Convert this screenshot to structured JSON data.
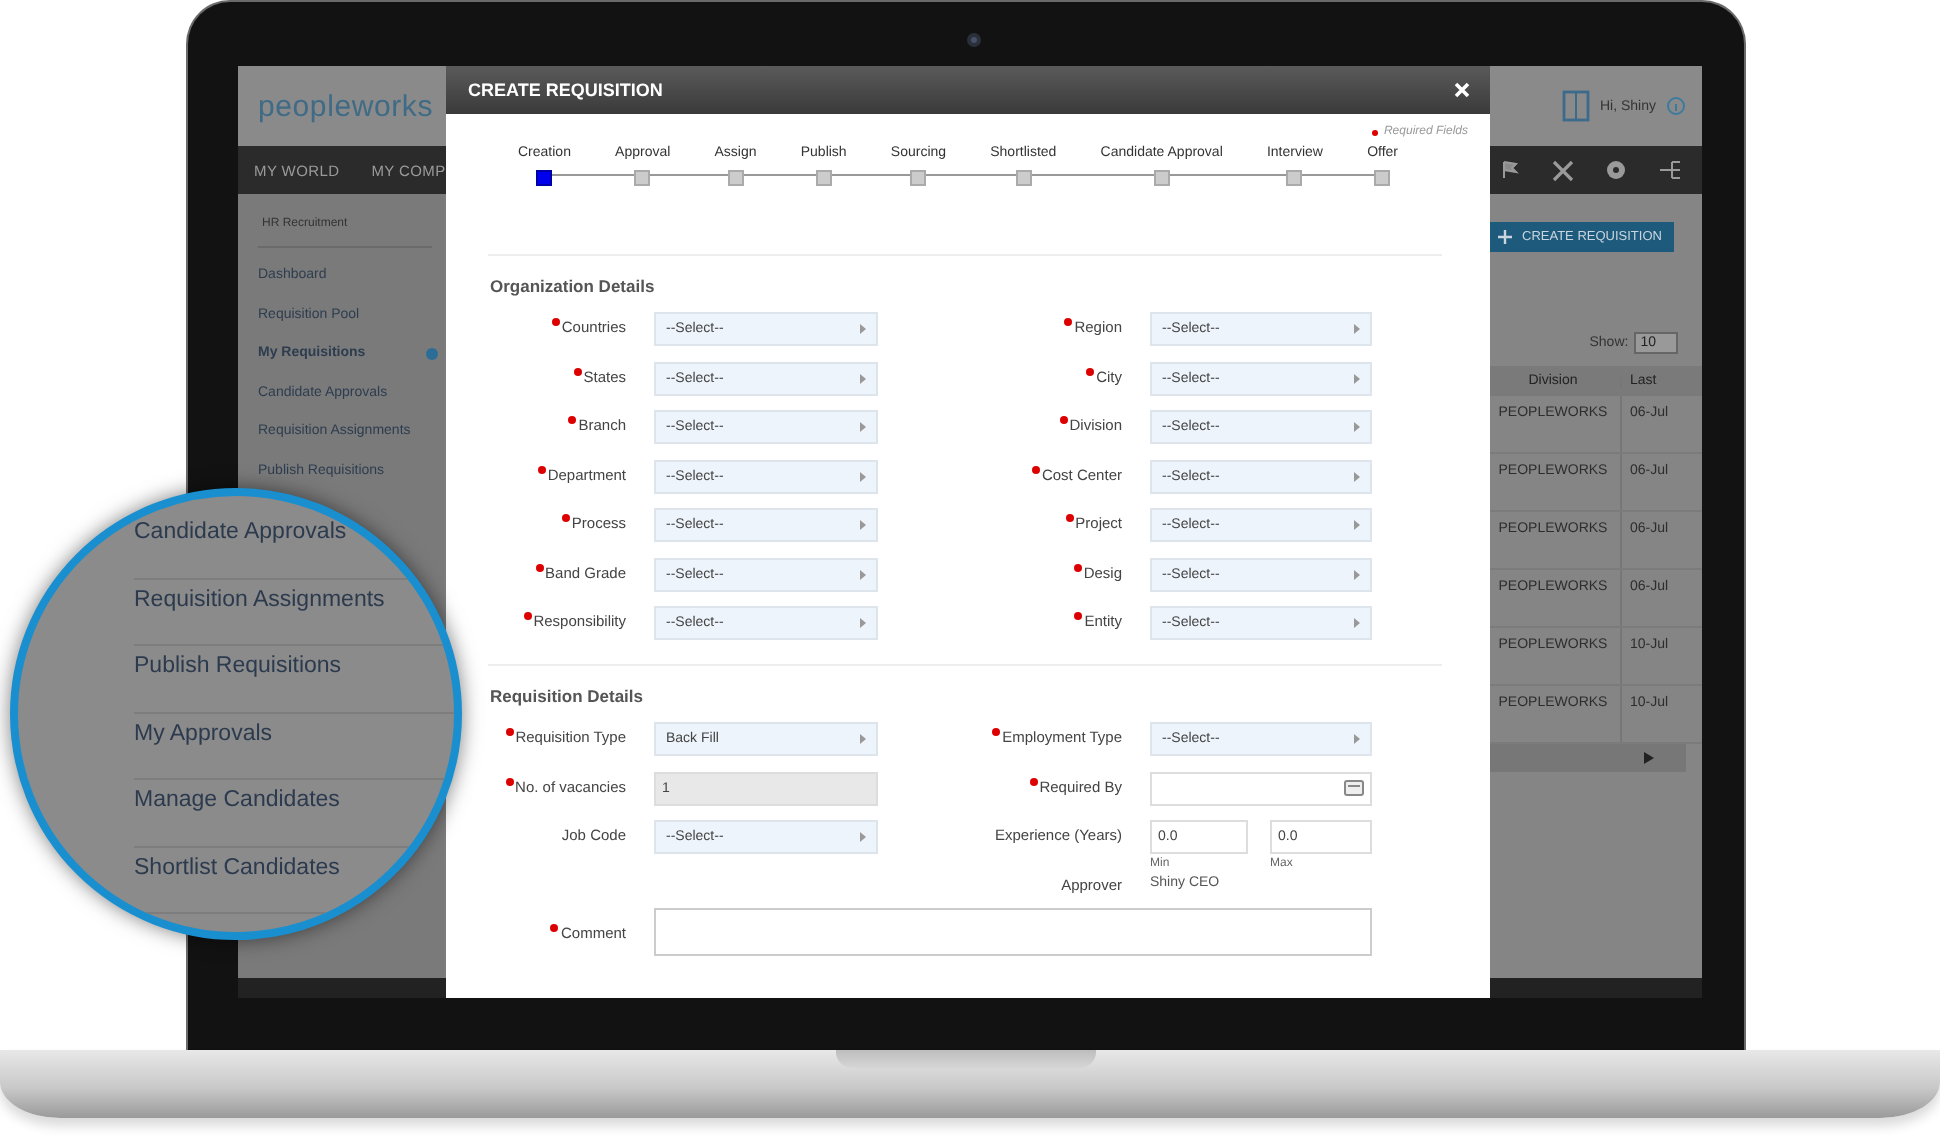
{
  "app": {
    "logo": "peopleworks",
    "greeting": "Hi, Shiny",
    "nav": [
      "MY WORLD",
      "MY COMP"
    ],
    "sidebar": {
      "heading": "HR Recruitment",
      "items": [
        {
          "label": "Dashboard",
          "selected": false
        },
        {
          "label": "Requisition Pool",
          "selected": false
        },
        {
          "label": "My Requisitions",
          "selected": true
        },
        {
          "label": "Candidate Approvals",
          "selected": false
        },
        {
          "label": "Requisition Assignments",
          "selected": false
        },
        {
          "label": "Publish Requisitions",
          "selected": false
        }
      ]
    },
    "create_button": "CREATE REQUISITION",
    "show": {
      "label": "Show:",
      "value": "10"
    },
    "table": {
      "columns": [
        "Division",
        "Last"
      ],
      "rows": [
        [
          "PEOPLEWORKS",
          "06-Jul"
        ],
        [
          "PEOPLEWORKS",
          "06-Jul"
        ],
        [
          "PEOPLEWORKS",
          "06-Jul"
        ],
        [
          "PEOPLEWORKS",
          "06-Jul"
        ],
        [
          "PEOPLEWORKS",
          "10-Jul"
        ],
        [
          "PEOPLEWORKS",
          "10-Jul"
        ]
      ]
    }
  },
  "modal": {
    "title": "CREATE REQUISITION",
    "required_note": "Required Fields",
    "steps": [
      {
        "label": "Creation",
        "selected": true
      },
      {
        "label": "Approval",
        "selected": false
      },
      {
        "label": "Assign",
        "selected": false
      },
      {
        "label": "Publish",
        "selected": false
      },
      {
        "label": "Sourcing",
        "selected": false
      },
      {
        "label": "Shortlisted",
        "selected": false
      },
      {
        "label": "Candidate Approval",
        "selected": false
      },
      {
        "label": "Interview",
        "selected": false
      },
      {
        "label": "Offer",
        "selected": false
      }
    ],
    "sections": [
      {
        "title": "Organization Details",
        "rows": [
          {
            "left": {
              "kind": "select",
              "label": "Countries",
              "required": true,
              "value": "--Select--"
            },
            "right": {
              "kind": "select",
              "label": "Region",
              "required": true,
              "value": "--Select--"
            }
          },
          {
            "left": {
              "kind": "select",
              "label": "States",
              "required": true,
              "value": "--Select--"
            },
            "right": {
              "kind": "select",
              "label": "City",
              "required": true,
              "value": "--Select--"
            }
          },
          {
            "left": {
              "kind": "select",
              "label": "Branch",
              "required": true,
              "value": "--Select--"
            },
            "right": {
              "kind": "select",
              "label": "Division",
              "required": true,
              "value": "--Select--"
            }
          },
          {
            "left": {
              "kind": "select",
              "label": "Department",
              "required": true,
              "value": "--Select--"
            },
            "right": {
              "kind": "select",
              "label": "Cost Center",
              "required": true,
              "value": "--Select--"
            }
          },
          {
            "left": {
              "kind": "select",
              "label": "Process",
              "required": true,
              "value": "--Select--"
            },
            "right": {
              "kind": "select",
              "label": "Project",
              "required": true,
              "value": "--Select--"
            }
          },
          {
            "left": {
              "kind": "select",
              "label": "Band Grade",
              "required": true,
              "value": "--Select--"
            },
            "right": {
              "kind": "select",
              "label": "Desig",
              "required": true,
              "value": "--Select--"
            }
          },
          {
            "left": {
              "kind": "select",
              "label": "Responsibility",
              "required": true,
              "value": "--Select--"
            },
            "right": {
              "kind": "select",
              "label": "Entity",
              "required": true,
              "value": "--Select--"
            }
          }
        ]
      },
      {
        "title": "Requisition Details",
        "rows": [
          {
            "left": {
              "kind": "select",
              "label": "Requisition Type",
              "required": true,
              "value": "Back Fill"
            },
            "right": {
              "kind": "select",
              "label": "Employment Type",
              "required": true,
              "value": "--Select--"
            }
          },
          {
            "left": {
              "kind": "text",
              "label": "No. of vacancies",
              "required": true,
              "value": "1",
              "disabled": true
            },
            "right": {
              "kind": "date",
              "label": "Required By",
              "required": true
            }
          },
          {
            "left": {
              "kind": "select",
              "label": "Job Code",
              "required": false,
              "value": "--Select--"
            },
            "right": {
              "kind": "range",
              "label": "Experience (Years)",
              "required": false,
              "min": {
                "value": "0.0",
                "caption": "Min"
              },
              "max": {
                "value": "0.0",
                "caption": "Max"
              }
            }
          },
          {
            "right": {
              "kind": "static",
              "label": "Approver",
              "required": false,
              "value": "Shiny CEO"
            }
          },
          {
            "left": {
              "kind": "textarea",
              "label": "Comment",
              "required": true
            }
          }
        ]
      }
    ]
  },
  "magnifier": {
    "items": [
      {
        "label": "Candidate Approvals",
        "selected": false
      },
      {
        "label": "Requisition Assignments",
        "selected": false
      },
      {
        "label": "Publish Requisitions",
        "selected": false
      },
      {
        "label": "My Approvals",
        "selected": false
      },
      {
        "label": "Manage Candidates",
        "selected": false
      },
      {
        "label": "Shortlist Candidates",
        "selected": false
      }
    ]
  }
}
